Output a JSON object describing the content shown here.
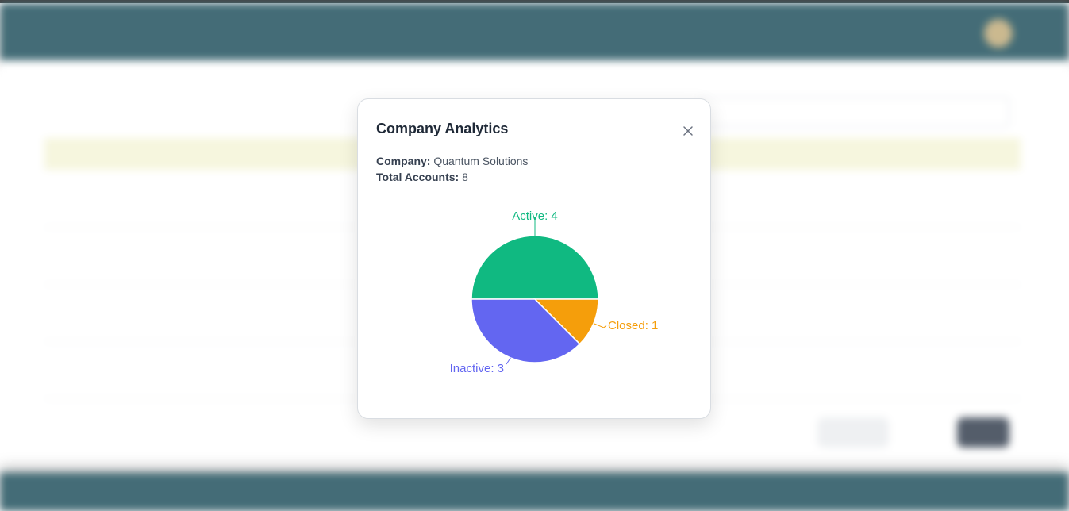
{
  "colors": {
    "navbar": "#3a6570",
    "active": "#10b981",
    "closed": "#f59e0b",
    "inactive": "#6366f1",
    "table_head": "#f6f6dd"
  },
  "modal": {
    "title": "Company Analytics",
    "close_icon": "close-icon",
    "company_label": "Company:",
    "company_value": "Quantum Solutions",
    "accounts_label": "Total Accounts:",
    "accounts_value": "8"
  },
  "chart_data": {
    "type": "pie",
    "slices": [
      {
        "name": "Active",
        "value": 4,
        "label": "Active: 4",
        "color": "#10b981"
      },
      {
        "name": "Closed",
        "value": 1,
        "label": "Closed: 1",
        "color": "#f59e0b"
      },
      {
        "name": "Inactive",
        "value": 3,
        "label": "Inactive: 3",
        "color": "#6366f1"
      }
    ]
  }
}
